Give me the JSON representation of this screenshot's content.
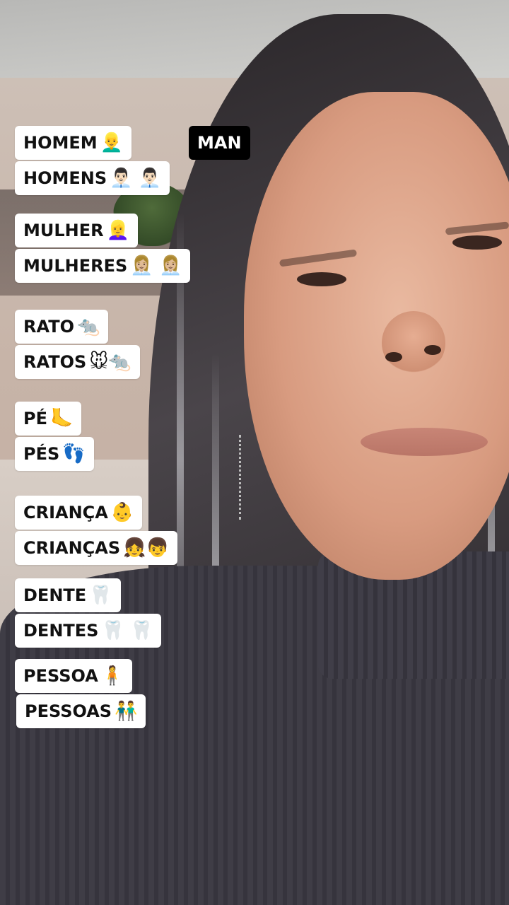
{
  "translation_label": "MAN",
  "captions": [
    {
      "text": "HOMEM",
      "emoji": "👱‍♂️"
    },
    {
      "text": "HOMENS",
      "emoji": "👨🏻‍💼 👨🏻‍💼"
    },
    {
      "text": "MULHER",
      "emoji": "👱‍♀️"
    },
    {
      "text": "MULHERES",
      "emoji": "👩🏼‍💼 👩🏼‍💼"
    },
    {
      "text": "RATO",
      "emoji": "🐀"
    },
    {
      "text": "RATOS",
      "emoji": "🐭🐀"
    },
    {
      "text": "PÉ",
      "emoji": "🦶"
    },
    {
      "text": "PÉS",
      "emoji": "👣"
    },
    {
      "text": "CRIANÇA",
      "emoji": "👶"
    },
    {
      "text": "CRIANÇAS",
      "emoji": "👧👦"
    },
    {
      "text": "DENTE",
      "emoji": "🦷"
    },
    {
      "text": "DENTES",
      "emoji": "🦷 🦷"
    },
    {
      "text": "PESSOA",
      "emoji": "🧍"
    },
    {
      "text": "PESSOAS",
      "emoji": "👬"
    }
  ]
}
